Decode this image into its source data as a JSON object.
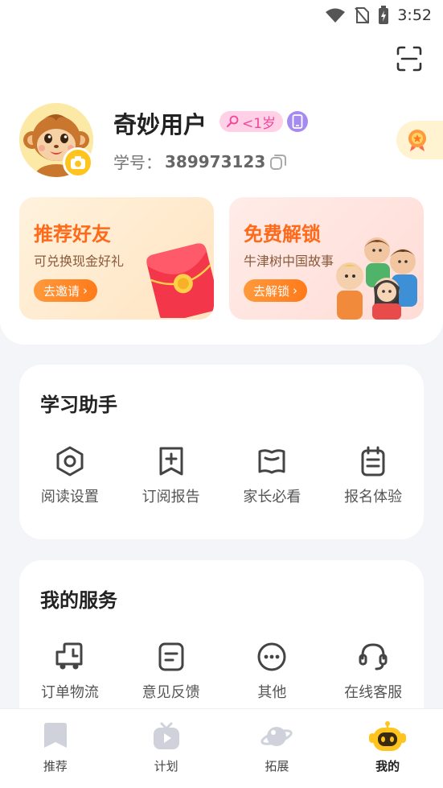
{
  "status_bar": {
    "time": "3:52"
  },
  "profile": {
    "username": "奇妙用户",
    "age_badge": "<1岁",
    "student_id_label": "学号：",
    "student_id": "389973123"
  },
  "promos": [
    {
      "title": "推荐好友",
      "subtitle": "可兑换现金好礼",
      "button": "去邀请"
    },
    {
      "title": "免费解锁",
      "subtitle": "牛津树中国故事",
      "button": "去解锁"
    }
  ],
  "study_assistant": {
    "title": "学习助手",
    "items": [
      {
        "label": "阅读设置",
        "icon": "hexagon-settings-icon"
      },
      {
        "label": "订阅报告",
        "icon": "bookmark-plus-icon"
      },
      {
        "label": "家长必看",
        "icon": "book-icon"
      },
      {
        "label": "报名体验",
        "icon": "clipboard-icon"
      }
    ]
  },
  "my_services": {
    "title": "我的服务",
    "items": [
      {
        "label": "订单物流",
        "icon": "delivery-truck-icon"
      },
      {
        "label": "意见反馈",
        "icon": "feedback-icon"
      },
      {
        "label": "其他",
        "icon": "more-icon"
      },
      {
        "label": "在线客服",
        "icon": "headset-icon"
      }
    ]
  },
  "tabbar": [
    {
      "label": "推荐",
      "active": false
    },
    {
      "label": "计划",
      "active": false
    },
    {
      "label": "拓展",
      "active": false
    },
    {
      "label": "我的",
      "active": true
    }
  ],
  "colors": {
    "accent": "#ff6a1a",
    "active_tab": "#ffc41d",
    "background": "#f4f5f9"
  }
}
